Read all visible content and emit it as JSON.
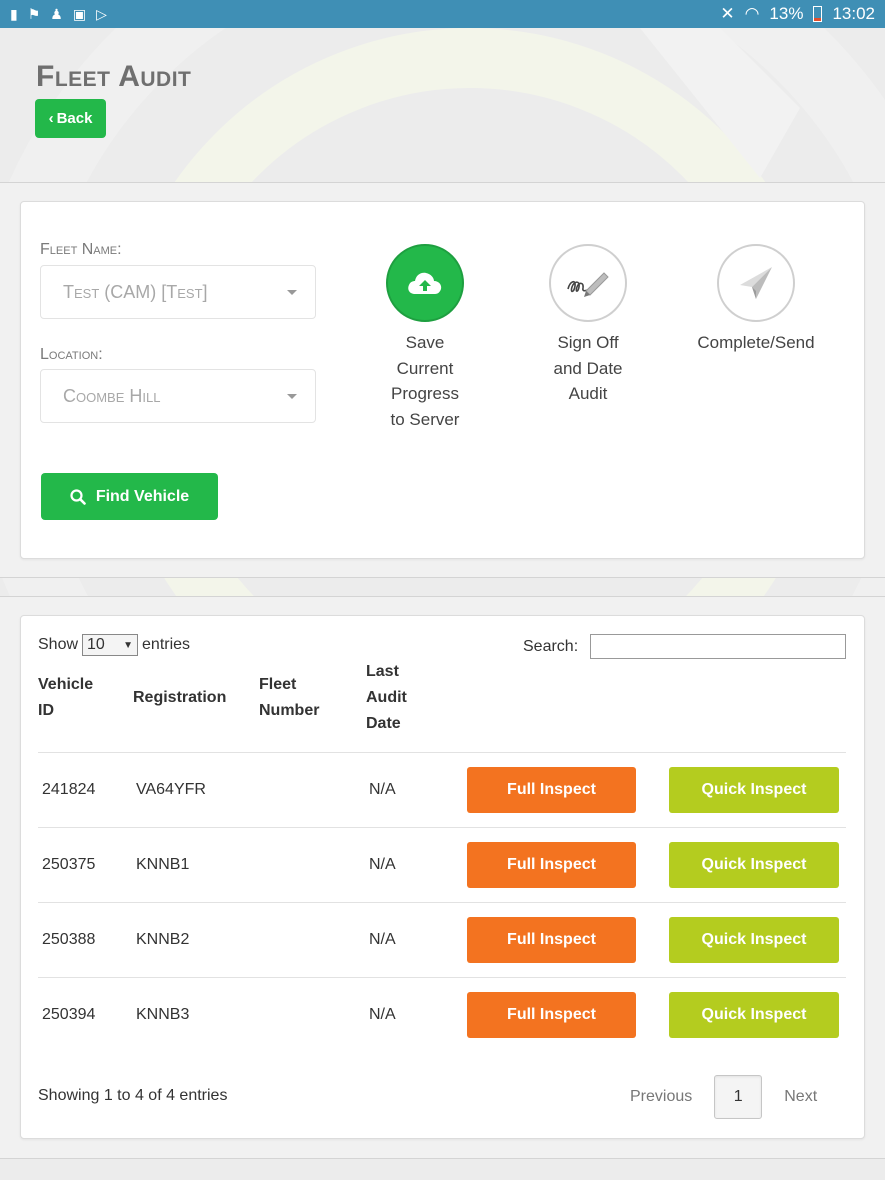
{
  "statusbar": {
    "left_icons": [
      "card-icon",
      "flag-icon",
      "person-icon",
      "image-icon",
      "play-icon"
    ],
    "battery": "13%",
    "time": "13:02"
  },
  "header": {
    "title": "Fleet Audit",
    "back_label": "Back"
  },
  "filters": {
    "fleet_name_label": "Fleet Name:",
    "fleet_name_value": "Test (CAM) [Test]",
    "location_label": "Location:",
    "location_value": "Coombe Hill",
    "find_vehicle_label": "Find Vehicle"
  },
  "actions": {
    "save": {
      "line1": "Save",
      "line2": "Current",
      "line3": "Progress",
      "line4": "to Server"
    },
    "signoff": {
      "line1": "Sign Off",
      "line2": "and Date",
      "line3": "Audit"
    },
    "complete": {
      "line1": "Complete/Send"
    }
  },
  "table": {
    "show_label": "Show",
    "entries_label": "entries",
    "page_length": "10",
    "search_label": "Search:",
    "search_value": "",
    "columns": {
      "vehicle_id": {
        "l1": "Vehicle",
        "l2": "ID"
      },
      "registration": {
        "l1": "Registration"
      },
      "fleet_number": {
        "l1": "Fleet",
        "l2": "Number"
      },
      "last_audit_date": {
        "l1": "Last",
        "l2": "Audit",
        "l3": "Date"
      }
    },
    "rows": [
      {
        "vehicle_id": "241824",
        "registration": "VA64YFR",
        "fleet_number": "",
        "last_audit_date": "N/A",
        "full_label": "Full Inspect",
        "quick_label": "Quick Inspect"
      },
      {
        "vehicle_id": "250375",
        "registration": "KNNB1",
        "fleet_number": "",
        "last_audit_date": "N/A",
        "full_label": "Full Inspect",
        "quick_label": "Quick Inspect"
      },
      {
        "vehicle_id": "250388",
        "registration": "KNNB2",
        "fleet_number": "",
        "last_audit_date": "N/A",
        "full_label": "Full Inspect",
        "quick_label": "Quick Inspect"
      },
      {
        "vehicle_id": "250394",
        "registration": "KNNB3",
        "fleet_number": "",
        "last_audit_date": "N/A",
        "full_label": "Full Inspect",
        "quick_label": "Quick Inspect"
      }
    ],
    "info": "Showing 1 to 4 of 4 entries",
    "pagination": {
      "previous": "Previous",
      "current_page": "1",
      "next": "Next"
    }
  },
  "colors": {
    "statusbar": "#3f8fb5",
    "primary_green": "#23b84a",
    "full_inspect_orange": "#f37320",
    "quick_inspect_lime": "#b4cc1f"
  }
}
